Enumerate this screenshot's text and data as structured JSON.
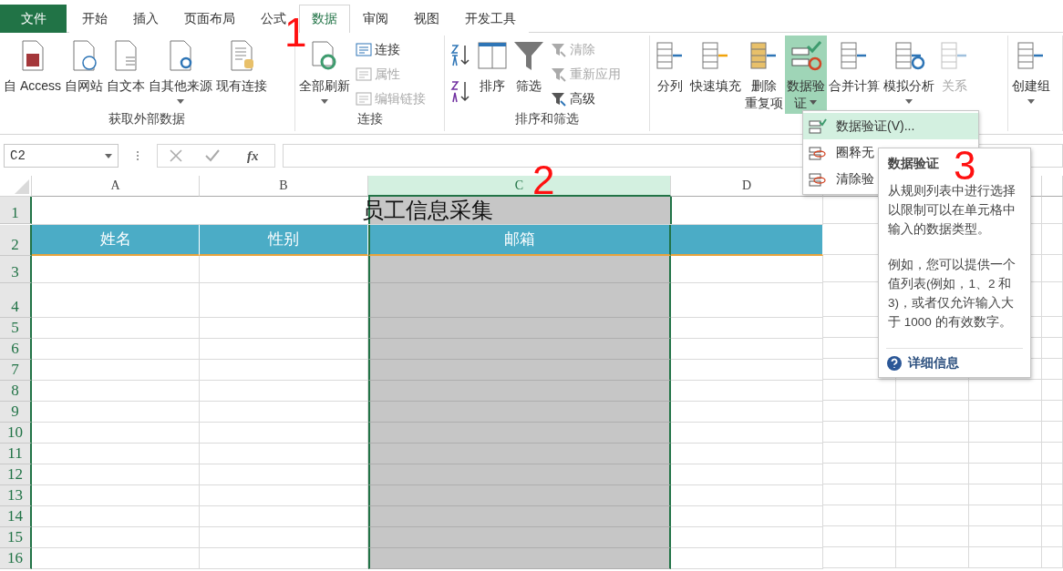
{
  "tabs": [
    {
      "label": "文件",
      "kind": "file",
      "selected": false
    },
    {
      "label": "开始",
      "kind": "tab",
      "selected": false
    },
    {
      "label": "插入",
      "kind": "tab",
      "selected": false
    },
    {
      "label": "页面布局",
      "kind": "tab",
      "selected": false
    },
    {
      "label": "公式",
      "kind": "tab",
      "selected": false
    },
    {
      "label": "数据",
      "kind": "tab",
      "selected": true
    },
    {
      "label": "审阅",
      "kind": "tab",
      "selected": false
    },
    {
      "label": "视图",
      "kind": "tab",
      "selected": false
    },
    {
      "label": "开发工具",
      "kind": "tab",
      "selected": false
    }
  ],
  "ribbon": {
    "groups": [
      {
        "label": "获取外部数据",
        "items": [
          {
            "kind": "large",
            "lines": [
              "自 Access"
            ],
            "dropdown": false,
            "disabled": false,
            "selected": false
          },
          {
            "kind": "large",
            "lines": [
              "自网站"
            ],
            "dropdown": false,
            "disabled": false,
            "selected": false
          },
          {
            "kind": "large",
            "lines": [
              "自文本"
            ],
            "dropdown": false,
            "disabled": false,
            "selected": false
          },
          {
            "kind": "large",
            "lines": [
              "自其他来源"
            ],
            "dropdown": true,
            "disabled": false,
            "selected": false
          },
          {
            "kind": "large",
            "lines": [
              "现有连接"
            ],
            "dropdown": false,
            "disabled": false,
            "selected": false
          }
        ]
      },
      {
        "label": "连接",
        "items": [
          {
            "kind": "large",
            "lines": [
              "全部刷新"
            ],
            "dropdown": true,
            "disabled": false,
            "selected": false
          },
          {
            "kind": "stack",
            "buttons": [
              {
                "label": "连接",
                "disabled": false
              },
              {
                "label": "属性",
                "disabled": true
              },
              {
                "label": "编辑链接",
                "disabled": true
              }
            ]
          }
        ]
      },
      {
        "label": "排序和筛选",
        "items": [
          {
            "kind": "sort"
          },
          {
            "kind": "large",
            "lines": [
              "排序"
            ],
            "dropdown": false,
            "disabled": false,
            "selected": false
          },
          {
            "kind": "large",
            "lines": [
              "筛选"
            ],
            "dropdown": false,
            "disabled": false,
            "selected": false
          },
          {
            "kind": "stack",
            "buttons": [
              {
                "label": "清除",
                "disabled": true
              },
              {
                "label": "重新应用",
                "disabled": true
              },
              {
                "label": "高级",
                "disabled": false
              }
            ]
          }
        ]
      },
      {
        "items": [
          {
            "kind": "large",
            "lines": [
              "分列"
            ],
            "dropdown": false,
            "disabled": false,
            "selected": false
          },
          {
            "kind": "large",
            "lines": [
              "快速填充"
            ],
            "dropdown": false,
            "disabled": false,
            "selected": false
          },
          {
            "kind": "large",
            "lines": [
              "删除",
              "重复项"
            ],
            "dropdown": false,
            "disabled": false,
            "selected": false
          },
          {
            "kind": "large",
            "lines": [
              "数据验",
              "证"
            ],
            "dropdown": true,
            "disabled": false,
            "selected": true
          },
          {
            "kind": "large",
            "lines": [
              "合并计算"
            ],
            "dropdown": false,
            "disabled": false,
            "selected": false
          },
          {
            "kind": "large",
            "lines": [
              "模拟分析"
            ],
            "dropdown": true,
            "disabled": false,
            "selected": false
          },
          {
            "kind": "large",
            "lines": [
              "关系"
            ],
            "dropdown": false,
            "disabled": true,
            "selected": false
          }
        ]
      },
      {
        "items": [
          {
            "kind": "large",
            "lines": [
              "创建组"
            ],
            "dropdown": true,
            "disabled": false,
            "selected": false
          }
        ]
      }
    ]
  },
  "formula_bar": {
    "name_box": "C2",
    "more": "⁝",
    "fx": "fx"
  },
  "sheet": {
    "columns": [
      {
        "label": "A",
        "selected": false
      },
      {
        "label": "B",
        "selected": false
      },
      {
        "label": "C",
        "selected": true
      },
      {
        "label": "D",
        "selected": false
      }
    ],
    "row_headers": [
      "1",
      "2",
      "3",
      "4",
      "5",
      "6",
      "7",
      "8",
      "9",
      "10",
      "11",
      "12",
      "13",
      "14",
      "15",
      "16"
    ],
    "title": "员工信息采集",
    "header_cells": [
      "姓名",
      "性别",
      "邮箱"
    ]
  },
  "dropdown_menu": {
    "items": [
      {
        "label": "数据验证(V)...",
        "selected": true
      },
      {
        "label": "圈释无",
        "selected": false
      },
      {
        "label": "清除验",
        "selected": false
      }
    ]
  },
  "tooltip": {
    "title": "数据验证",
    "paragraphs": [
      "从规则列表中进行选择以限制可以在单元格中输入的数据类型。",
      "例如，您可以提供一个值列表(例如，1、2 和 3)，或者仅允许输入大于 1000 的有效数字。"
    ],
    "link": "详细信息"
  },
  "annotations": [
    {
      "text": "1"
    },
    {
      "text": "2"
    },
    {
      "text": "3"
    }
  ]
}
